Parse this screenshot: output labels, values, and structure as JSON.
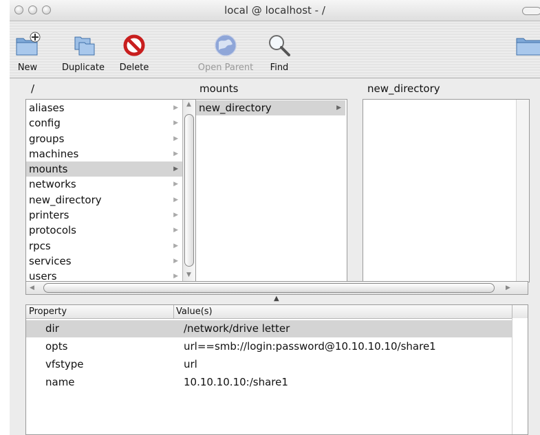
{
  "window": {
    "title": "local @ localhost - /"
  },
  "toolbar": {
    "new_label": "New",
    "duplicate_label": "Duplicate",
    "delete_label": "Delete",
    "open_parent_label": "Open Parent",
    "find_label": "Find"
  },
  "browser": {
    "col1_header": "/",
    "col2_header": "mounts",
    "col3_header": "new_directory",
    "col1_items": [
      "aliases",
      "config",
      "groups",
      "machines",
      "mounts",
      "networks",
      "new_directory",
      "printers",
      "protocols",
      "rpcs",
      "services",
      "users"
    ],
    "col1_selected": "mounts",
    "col2_items": [
      "new_directory"
    ]
  },
  "properties": {
    "header_property": "Property",
    "header_values": "Value(s)",
    "rows": [
      {
        "key": "dir",
        "value": "/network/drive letter"
      },
      {
        "key": "opts",
        "value": "url==smb://login:password@10.10.10.10/share1"
      },
      {
        "key": "vfstype",
        "value": "url"
      },
      {
        "key": "name",
        "value": "10.10.10.10:/share1"
      }
    ]
  },
  "icons": {
    "new": "new-folder-icon",
    "duplicate": "duplicate-icon",
    "delete": "delete-icon",
    "open_parent": "globe-icon",
    "find": "magnifier-icon",
    "folder": "folder-icon"
  }
}
